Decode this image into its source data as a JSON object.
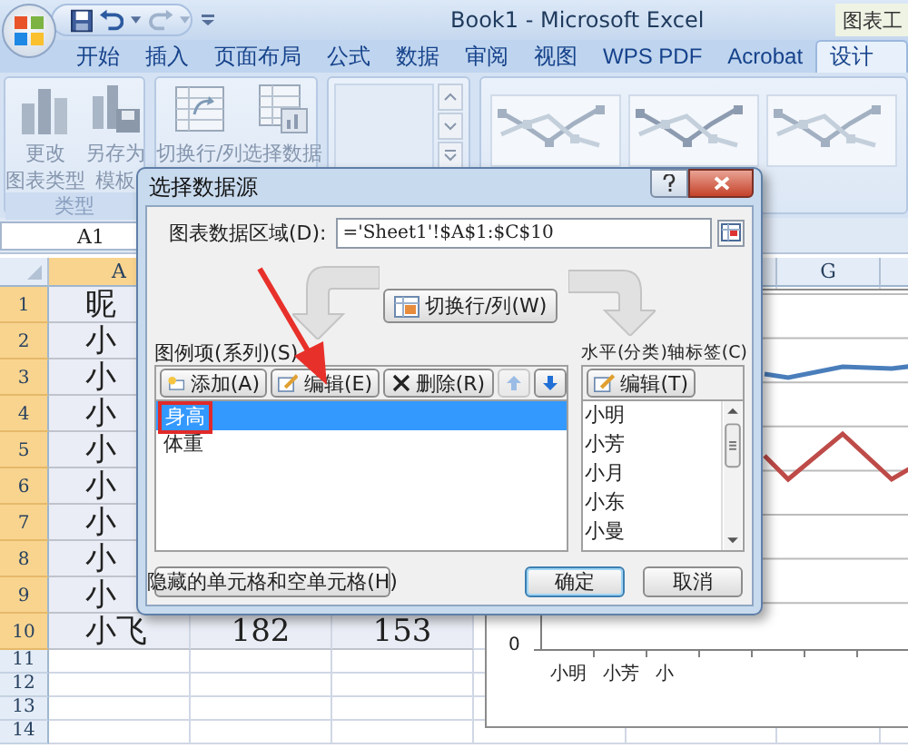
{
  "window": {
    "title": "Book1 - Microsoft Excel",
    "context_tab": "图表工"
  },
  "ribbon_tabs": [
    {
      "label": "开始",
      "selected": false
    },
    {
      "label": "插入",
      "selected": false
    },
    {
      "label": "页面布局",
      "selected": false
    },
    {
      "label": "公式",
      "selected": false
    },
    {
      "label": "数据",
      "selected": false
    },
    {
      "label": "审阅",
      "selected": false
    },
    {
      "label": "视图",
      "selected": false
    },
    {
      "label": "WPS PDF",
      "selected": false
    },
    {
      "label": "Acrobat",
      "selected": false
    },
    {
      "label": "设计",
      "selected": true
    }
  ],
  "ribbon_groups": [
    {
      "label": "类型",
      "buttons": [
        {
          "lines": [
            "更改",
            "图表类型"
          ],
          "kind": "chart-type"
        },
        {
          "lines": [
            "另存为",
            "模板"
          ],
          "kind": "template"
        }
      ]
    },
    {
      "buttons": [
        {
          "lines": [
            "切换行/列"
          ],
          "kind": "switch"
        },
        {
          "lines": [
            "选择数据"
          ],
          "kind": "select-data"
        }
      ]
    }
  ],
  "sheet": {
    "name_box": "A1",
    "columns": [
      {
        "label": "A",
        "selected": true
      },
      {
        "label": "G",
        "selected": false
      }
    ],
    "rows": [
      {
        "header": "1",
        "selected": true,
        "cells": [
          "昵"
        ]
      },
      {
        "header": "2",
        "selected": true,
        "cells": [
          "小"
        ]
      },
      {
        "header": "3",
        "selected": true,
        "cells": [
          "小"
        ]
      },
      {
        "header": "4",
        "selected": true,
        "cells": [
          "小"
        ]
      },
      {
        "header": "5",
        "selected": true,
        "cells": [
          "小"
        ]
      },
      {
        "header": "6",
        "selected": true,
        "cells": [
          "小"
        ]
      },
      {
        "header": "7",
        "selected": true,
        "cells": [
          "小"
        ]
      },
      {
        "header": "8",
        "selected": true,
        "cells": [
          "小"
        ]
      },
      {
        "header": "9",
        "selected": true,
        "cells": [
          "小"
        ]
      },
      {
        "header": "10",
        "selected": true,
        "cells": [
          "小飞",
          "182",
          "153"
        ]
      },
      {
        "header": "11",
        "selected": false
      },
      {
        "header": "12",
        "selected": false
      },
      {
        "header": "13",
        "selected": false
      },
      {
        "header": "14",
        "selected": false
      }
    ]
  },
  "chart": {
    "y_tick": "0",
    "x_labels": [
      "小明",
      "小芳",
      "小"
    ]
  },
  "dialog": {
    "title": "选择数据源",
    "range_label": "图表数据区域(D):",
    "range_value": "='Sheet1'!$A$1:$C$10",
    "switch_button": "切换行/列(W)",
    "series_label": "图例项(系列)(S)",
    "series_toolbar": [
      {
        "kind": "add",
        "label": "添加(A)",
        "disabled": false
      },
      {
        "kind": "edit",
        "label": "编辑(E)",
        "disabled": false
      },
      {
        "kind": "delete",
        "label": "删除(R)",
        "disabled": false
      },
      {
        "kind": "up",
        "disabled": true
      },
      {
        "kind": "down",
        "disabled": false
      }
    ],
    "series": [
      {
        "name": "身高",
        "selected": true,
        "highlighted": true
      },
      {
        "name": "体重",
        "selected": false,
        "highlighted": false
      }
    ],
    "axis_label": "水平(分类)轴标签(C)",
    "axis_edit_button": "编辑(T)",
    "categories": [
      "小明",
      "小芳",
      "小月",
      "小东",
      "小曼"
    ],
    "hidden_cells_button": "隐藏的单元格和空单元格(H)",
    "ok_button": "确定",
    "cancel_button": "取消"
  }
}
